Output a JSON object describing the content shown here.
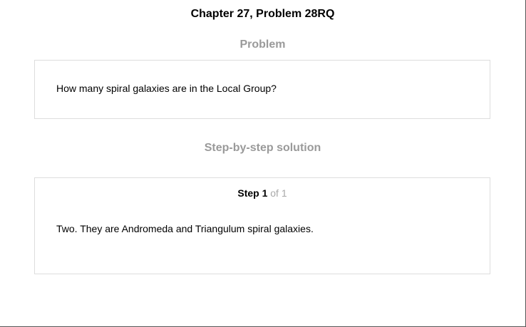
{
  "title": "Chapter 27, Problem 28RQ",
  "problem": {
    "heading": "Problem",
    "text": "How many spiral galaxies are in the Local Group?"
  },
  "solution": {
    "heading": "Step-by-step solution",
    "step_label": "Step 1",
    "step_of": " of 1",
    "text": "Two. They are Andromeda and Triangulum spiral galaxies."
  },
  "colors": {
    "heading_gray": "#9a9a9a",
    "border": "#dddddd"
  }
}
